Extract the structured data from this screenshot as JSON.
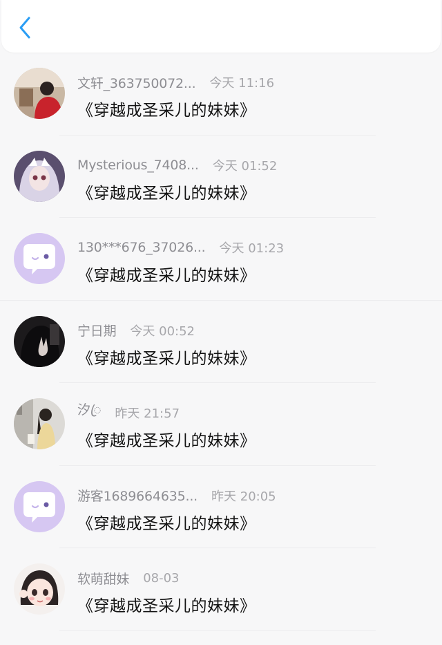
{
  "header": {
    "back_icon": "chevron-left-icon",
    "accent_color": "#2a9df4"
  },
  "messages": [
    {
      "name": "文轩_363750072...",
      "time": "今天 11:16",
      "text": "《穿越成圣采儿的妹妹》",
      "avatar": "photo-child-red"
    },
    {
      "name": "Mysterious_7408...",
      "time": "今天 01:52",
      "text": "《穿越成圣采儿的妹妹》",
      "avatar": "anime-girl"
    },
    {
      "name": "130***676_37026...",
      "time": "今天 01:23",
      "text": "《穿越成圣采儿的妹妹》",
      "avatar": "default-chat-bubble-icon"
    },
    {
      "name": "宁日期",
      "time": "今天 00:52",
      "text": "《穿越成圣采儿的妹妹》",
      "avatar": "dark-hand-photo"
    },
    {
      "name": "汐ꦿ",
      "time": "昨天 21:57",
      "text": "《穿越成圣采儿的妹妹》",
      "avatar": "girl-street-photo"
    },
    {
      "name": "游客1689664635...",
      "time": "昨天 20:05",
      "text": "《穿越成圣采儿的妹妹》",
      "avatar": "default-chat-bubble-icon"
    },
    {
      "name": "软萌甜妹",
      "time": "08-03",
      "text": "《穿越成圣采儿的妹妹》",
      "avatar": "cartoon-girl"
    }
  ]
}
